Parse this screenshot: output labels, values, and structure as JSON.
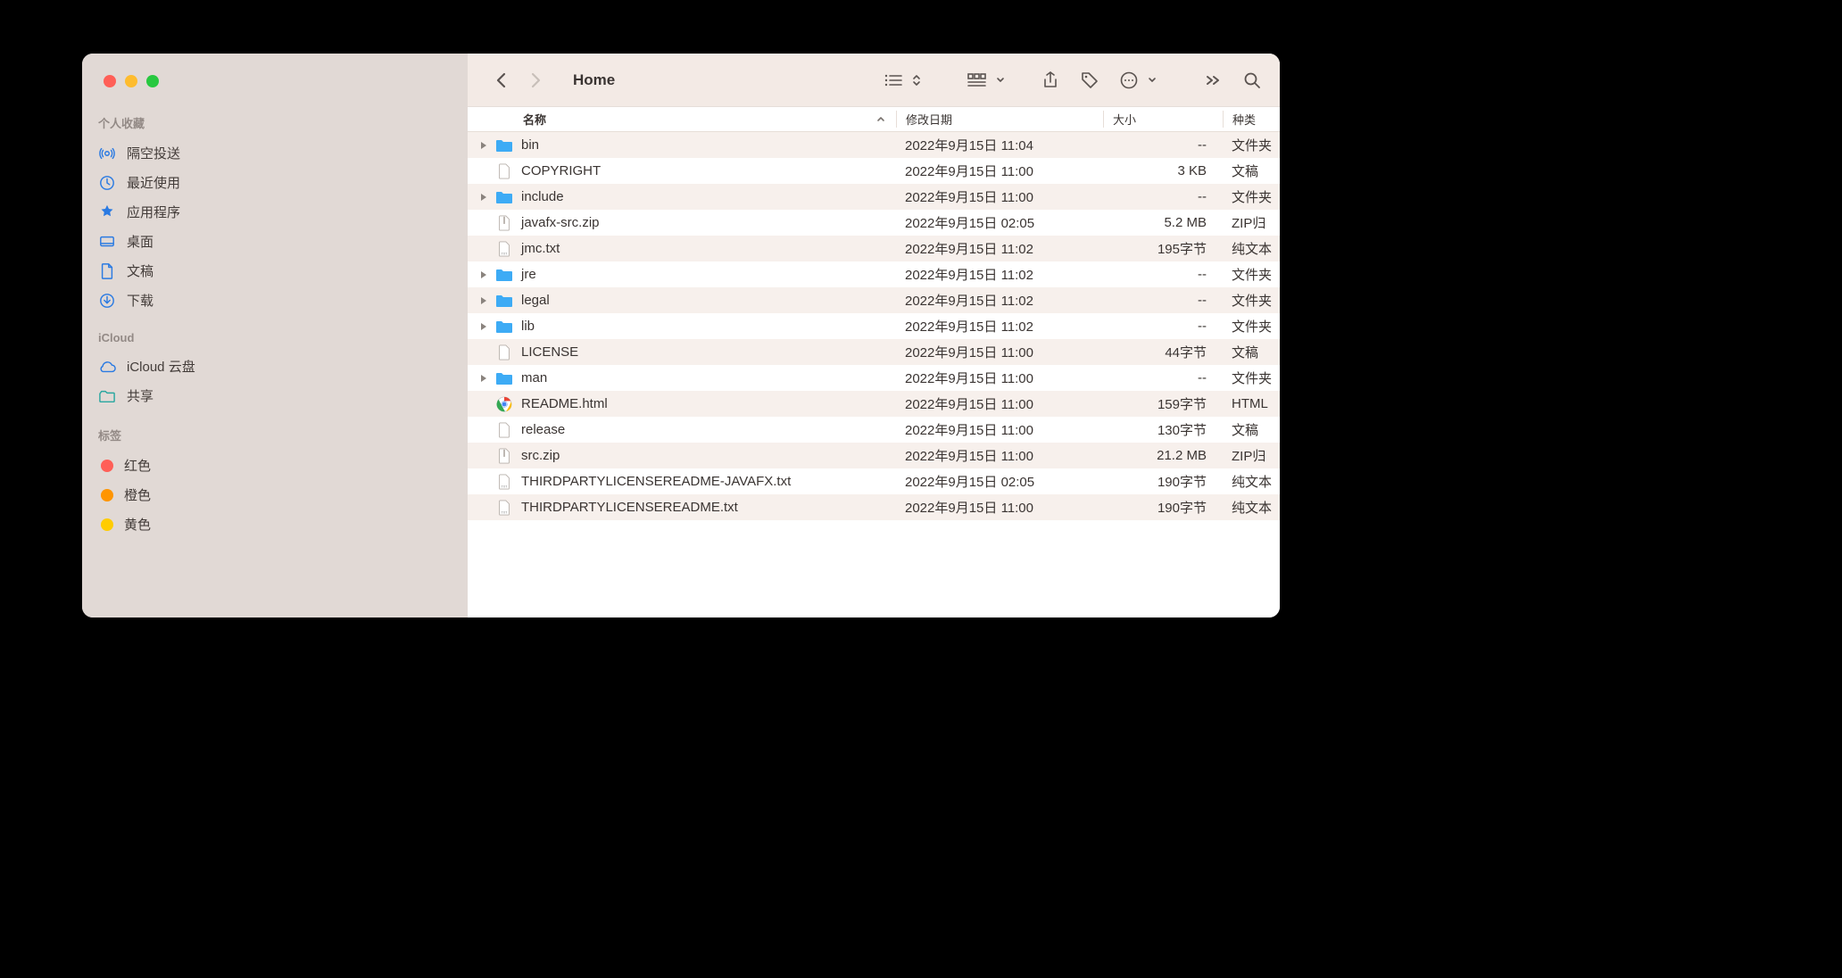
{
  "window_title": "Home",
  "sidebar": {
    "sections": [
      {
        "title": "个人收藏",
        "items": [
          {
            "icon": "airdrop",
            "label": "隔空投送"
          },
          {
            "icon": "clock",
            "label": "最近使用"
          },
          {
            "icon": "apps",
            "label": "应用程序"
          },
          {
            "icon": "desktop",
            "label": "桌面"
          },
          {
            "icon": "doc",
            "label": "文稿"
          },
          {
            "icon": "download",
            "label": "下载"
          }
        ]
      },
      {
        "title": "iCloud",
        "items": [
          {
            "icon": "cloud",
            "label": "iCloud 云盘"
          },
          {
            "icon": "shared",
            "label": "共享"
          }
        ]
      },
      {
        "title": "标签",
        "items": [
          {
            "icon": "tag",
            "color": "#ff5f57",
            "label": "红色"
          },
          {
            "icon": "tag",
            "color": "#ff9500",
            "label": "橙色"
          },
          {
            "icon": "tag",
            "color": "#ffcc00",
            "label": "黄色"
          }
        ]
      }
    ]
  },
  "columns": {
    "name": "名称",
    "date": "修改日期",
    "size": "大小",
    "kind": "种类"
  },
  "rows": [
    {
      "folder": true,
      "name": "bin",
      "date": "2022年9月15日 11:04",
      "size": "--",
      "kind": "文件夹"
    },
    {
      "folder": false,
      "icon": "doc",
      "name": "COPYRIGHT",
      "date": "2022年9月15日 11:00",
      "size": "3 KB",
      "kind": "文稿"
    },
    {
      "folder": true,
      "name": "include",
      "date": "2022年9月15日 11:00",
      "size": "--",
      "kind": "文件夹"
    },
    {
      "folder": false,
      "icon": "zip",
      "name": "javafx-src.zip",
      "date": "2022年9月15日 02:05",
      "size": "5.2 MB",
      "kind": "ZIP归"
    },
    {
      "folder": false,
      "icon": "txt",
      "name": "jmc.txt",
      "date": "2022年9月15日 11:02",
      "size": "195字节",
      "kind": "纯文本"
    },
    {
      "folder": true,
      "name": "jre",
      "date": "2022年9月15日 11:02",
      "size": "--",
      "kind": "文件夹"
    },
    {
      "folder": true,
      "name": "legal",
      "date": "2022年9月15日 11:02",
      "size": "--",
      "kind": "文件夹"
    },
    {
      "folder": true,
      "name": "lib",
      "date": "2022年9月15日 11:02",
      "size": "--",
      "kind": "文件夹"
    },
    {
      "folder": false,
      "icon": "doc",
      "name": "LICENSE",
      "date": "2022年9月15日 11:00",
      "size": "44字节",
      "kind": "文稿"
    },
    {
      "folder": true,
      "name": "man",
      "date": "2022年9月15日 11:00",
      "size": "--",
      "kind": "文件夹"
    },
    {
      "folder": false,
      "icon": "chrome",
      "name": "README.html",
      "date": "2022年9月15日 11:00",
      "size": "159字节",
      "kind": "HTML"
    },
    {
      "folder": false,
      "icon": "doc",
      "name": "release",
      "date": "2022年9月15日 11:00",
      "size": "130字节",
      "kind": "文稿"
    },
    {
      "folder": false,
      "icon": "zip",
      "name": "src.zip",
      "date": "2022年9月15日 11:00",
      "size": "21.2 MB",
      "kind": "ZIP归"
    },
    {
      "folder": false,
      "icon": "txt",
      "name": "THIRDPARTYLICENSEREADME-JAVAFX.txt",
      "date": "2022年9月15日 02:05",
      "size": "190字节",
      "kind": "纯文本"
    },
    {
      "folder": false,
      "icon": "txt",
      "name": "THIRDPARTYLICENSEREADME.txt",
      "date": "2022年9月15日 11:00",
      "size": "190字节",
      "kind": "纯文本"
    }
  ]
}
